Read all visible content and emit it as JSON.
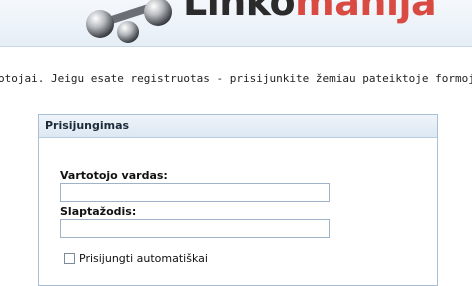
{
  "header": {
    "logo_word_dark": "Linko",
    "logo_word_red": "manija",
    "logo_icon": "dumbbell-logo-icon"
  },
  "intro_text": "otojai. Jeigu esate registruotas - prisijunkite žemiau pateiktoje formoje. Jeigu no",
  "login_panel": {
    "title": "Prisijungimas",
    "username_label": "Vartotojo vardas:",
    "username_value": "",
    "password_label": "Slaptažodis:",
    "password_value": "",
    "remember_label": "Prisijungti automatiškai",
    "remember_checked": false
  },
  "colors": {
    "accent_red": "#d94a43",
    "panel_border": "#a9bfd6"
  }
}
